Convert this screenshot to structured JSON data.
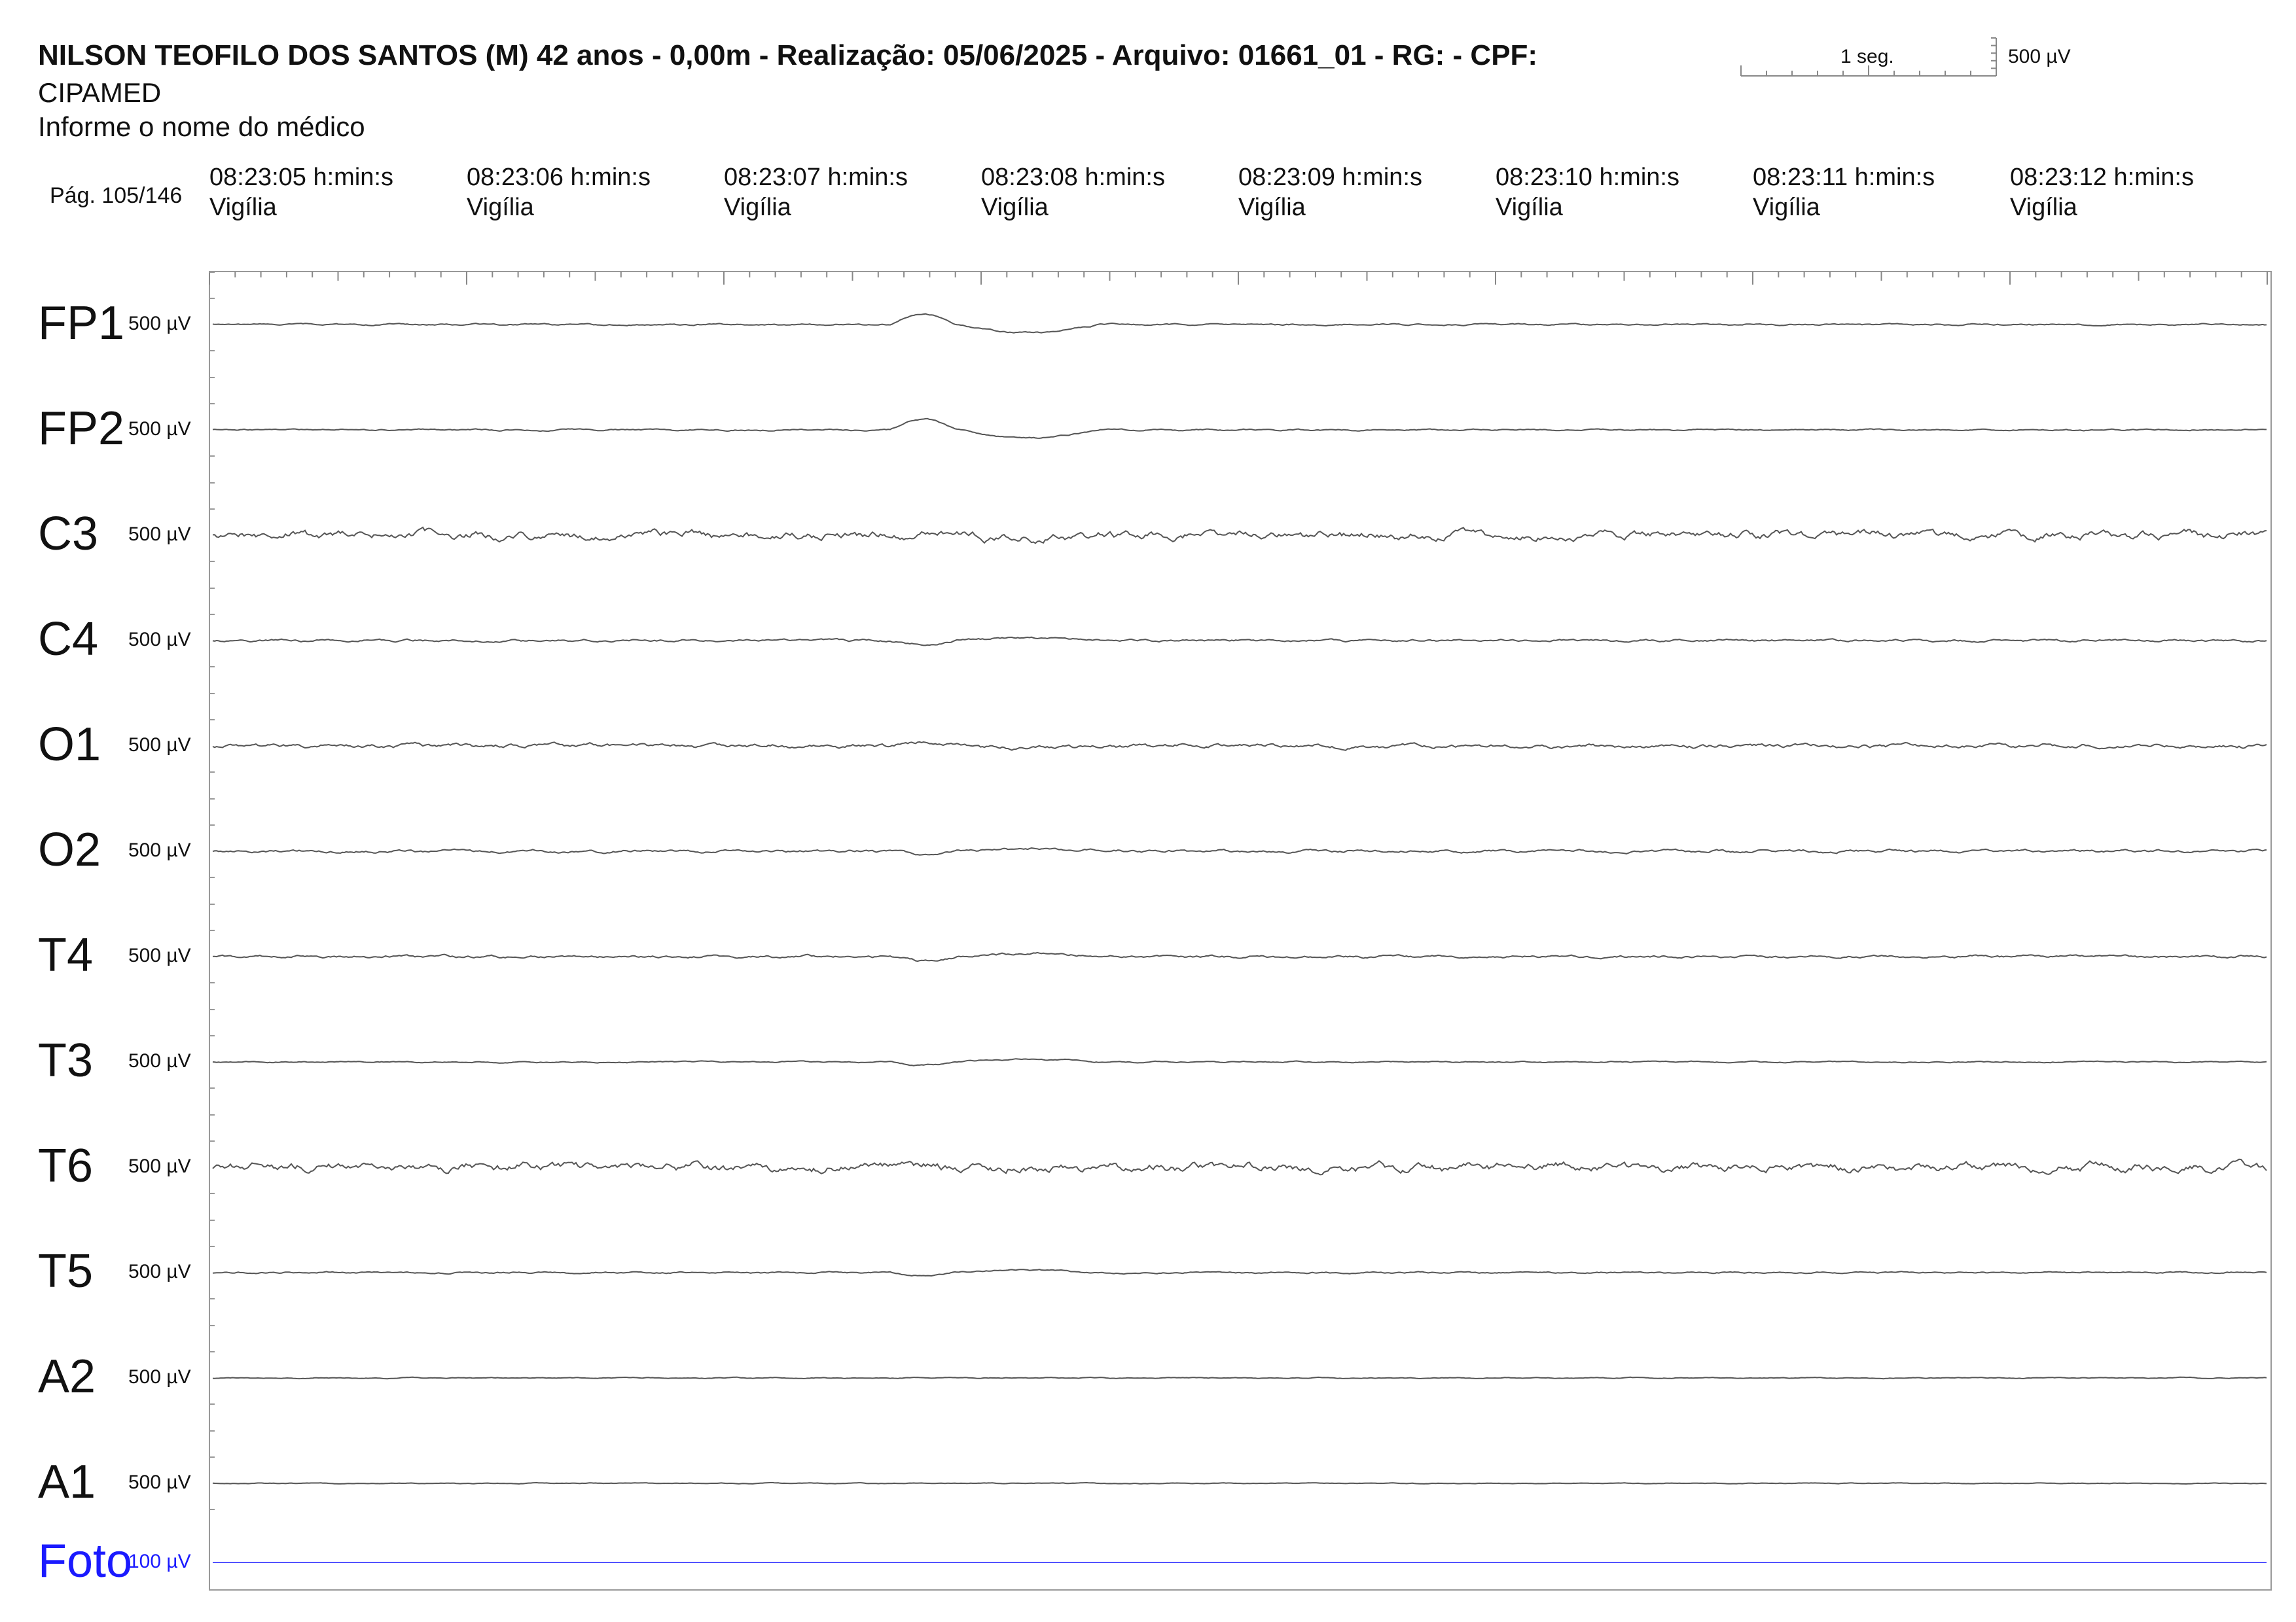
{
  "header": {
    "title": "NILSON TEOFILO DOS SANTOS (M) 42 anos - 0,00m - Realização: 05/06/2025 - Arquivo: 01661_01 - RG:  - CPF:",
    "clinic": "CIPAMED",
    "doctor": "Informe o nome do médico",
    "page": "Pág. 105/146"
  },
  "scale": {
    "time_label": "1 seg.",
    "amp_label": "500 µV"
  },
  "timestamps": [
    {
      "time": "08:23:05 h:min:s",
      "state": "Vigília"
    },
    {
      "time": "08:23:06 h:min:s",
      "state": "Vigília"
    },
    {
      "time": "08:23:07 h:min:s",
      "state": "Vigília"
    },
    {
      "time": "08:23:08 h:min:s",
      "state": "Vigília"
    },
    {
      "time": "08:23:09 h:min:s",
      "state": "Vigília"
    },
    {
      "time": "08:23:10 h:min:s",
      "state": "Vigília"
    },
    {
      "time": "08:23:11 h:min:s",
      "state": "Vigília"
    },
    {
      "time": "08:23:12 h:min:s",
      "state": "Vigília"
    }
  ],
  "colors": {
    "trace": "#555555",
    "photic": "#1a1aff",
    "frame": "#999999"
  },
  "chart_data": {
    "type": "line",
    "x_unit": "s",
    "xlim": [
      0,
      8
    ],
    "series": [
      {
        "name": "FP1",
        "sensitivity": "500 µV",
        "noise": 0.6,
        "event": -16
      },
      {
        "name": "FP2",
        "sensitivity": "500 µV",
        "noise": 0.6,
        "event": -16
      },
      {
        "name": "C3",
        "sensitivity": "500 µV",
        "noise": 3.2,
        "event": -4
      },
      {
        "name": "C4",
        "sensitivity": "500 µV",
        "noise": 0.9,
        "event": 5
      },
      {
        "name": "O1",
        "sensitivity": "500 µV",
        "noise": 1.6,
        "event": -5
      },
      {
        "name": "O2",
        "sensitivity": "500 µV",
        "noise": 1.1,
        "event": 4
      },
      {
        "name": "T4",
        "sensitivity": "500 µV",
        "noise": 1.0,
        "event": 6
      },
      {
        "name": "T3",
        "sensitivity": "500 µV",
        "noise": 0.5,
        "event": 5
      },
      {
        "name": "T6",
        "sensitivity": "500 µV",
        "noise": 3.4,
        "event": -2
      },
      {
        "name": "T5",
        "sensitivity": "500 µV",
        "noise": 0.6,
        "event": 5
      },
      {
        "name": "A2",
        "sensitivity": "500 µV",
        "noise": 0.4,
        "event": 0
      },
      {
        "name": "A1",
        "sensitivity": "500 µV",
        "noise": 0.3,
        "event": 0
      },
      {
        "name": "Foto",
        "sensitivity": "100 µV",
        "noise": 0,
        "event": 0
      }
    ]
  }
}
